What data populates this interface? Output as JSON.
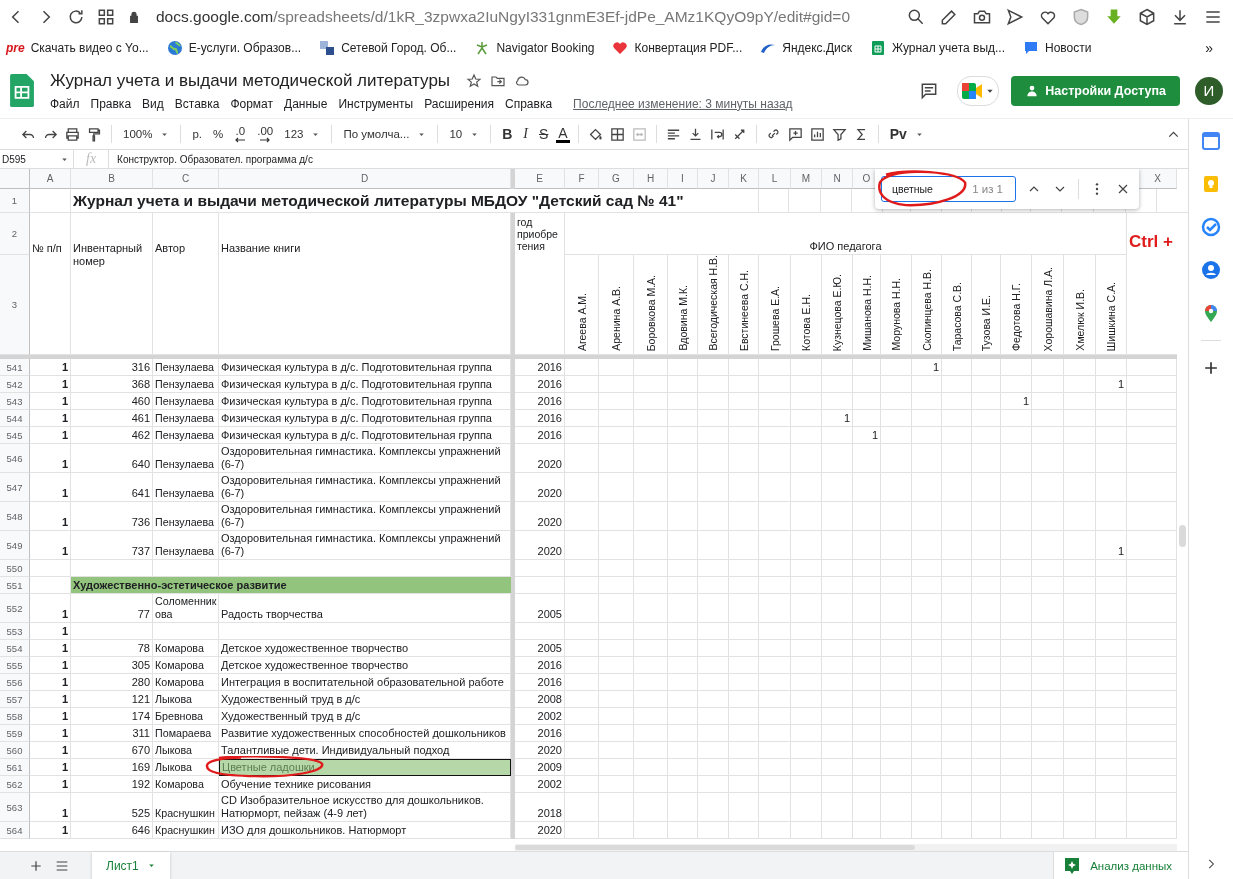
{
  "browser": {
    "url_host": "docs.google.com",
    "url_path": "/spreadsheets/d/1kR_3zpwxa2IuNgyI331gnmE3Ef-jdPe_AMz1KQyO9pY/edit#gid=0",
    "bookmarks": [
      {
        "kind": "pre",
        "logo": "pre",
        "label": "Скачать видео с Yo..."
      },
      {
        "kind": "globe",
        "label": "Е-услуги. Образов..."
      },
      {
        "kind": "tile",
        "label": "Сетевой Город. Об..."
      },
      {
        "kind": "figure",
        "label": "Navigator Booking"
      },
      {
        "kind": "heart",
        "label": "Конвертация PDF..."
      },
      {
        "kind": "disk",
        "label": "Яндекс.Диск"
      },
      {
        "kind": "sheets",
        "label": "Журнал учета выд..."
      },
      {
        "kind": "chat",
        "label": "Новости"
      }
    ],
    "overflow": "»"
  },
  "doc": {
    "title": "Журнал учета и выдачи методической литературы",
    "menu": [
      "Файл",
      "Правка",
      "Вид",
      "Вставка",
      "Формат",
      "Данные",
      "Инструменты",
      "Расширения",
      "Справка"
    ],
    "last_edit": "Последнее изменение: 3 минуты назад",
    "share_button": "Настройки Доступа",
    "avatar": "И"
  },
  "toolbar": [
    {
      "kind": "undo"
    },
    {
      "kind": "redo"
    },
    {
      "kind": "print"
    },
    {
      "kind": "paint"
    },
    {
      "kind": "sep"
    },
    {
      "kind": "dropdown",
      "label": "100%"
    },
    {
      "kind": "sep"
    },
    {
      "kind": "text",
      "label": "р."
    },
    {
      "kind": "text",
      "label": "%"
    },
    {
      "kind": "dec_less",
      "label": ".0"
    },
    {
      "kind": "dec_more",
      "label": ".00"
    },
    {
      "kind": "dropdown",
      "label": "123"
    },
    {
      "kind": "sep"
    },
    {
      "kind": "dropdown",
      "label": "По умолча..."
    },
    {
      "kind": "sep"
    },
    {
      "kind": "dropdown",
      "label": "10"
    },
    {
      "kind": "sep"
    },
    {
      "kind": "bold",
      "label": "B"
    },
    {
      "kind": "italic",
      "label": "I"
    },
    {
      "kind": "strike",
      "label": "S"
    },
    {
      "kind": "color",
      "label": "A"
    },
    {
      "kind": "sep"
    },
    {
      "kind": "fill"
    },
    {
      "kind": "borders"
    },
    {
      "kind": "merge"
    },
    {
      "kind": "sep"
    },
    {
      "kind": "halign"
    },
    {
      "kind": "valign"
    },
    {
      "kind": "wrap"
    },
    {
      "kind": "rotate"
    },
    {
      "kind": "sep"
    },
    {
      "kind": "link"
    },
    {
      "kind": "comment"
    },
    {
      "kind": "chart"
    },
    {
      "kind": "filter"
    },
    {
      "kind": "sigma"
    },
    {
      "kind": "sep"
    },
    {
      "kind": "addon",
      "label": "Pv"
    }
  ],
  "formula": {
    "cell": "D595",
    "fx": "fx",
    "content": "Конструктор. Образовател. программа д/с"
  },
  "find": {
    "query": "цветные",
    "count": "1 из 1"
  },
  "sheet": {
    "columns": [
      "A",
      "B",
      "C",
      "D",
      "E",
      "F",
      "G",
      "H",
      "I",
      "J",
      "K",
      "L",
      "M",
      "N",
      "O"
    ],
    "last_column": "X",
    "frozen_row_numbers": [
      "1",
      "2",
      "3"
    ],
    "title": "Журнал учета и выдачи методической литературы МБДОУ \"Детский сад № 41\"",
    "headers": [
      "№ п/п",
      "Инвентарный номер",
      "Автор",
      "Название книги",
      "год приобретения"
    ],
    "teacher_group": "ФИО педагога",
    "hint": "Ctrl +",
    "teachers": [
      "Агеева А.М.",
      "Аренина А.В.",
      "Боровкова М.А.",
      "Вдовина М.К.",
      "Всегодическая Н.В.",
      "Евстинеева С.Н.",
      "Грошева Е.А.",
      "Котова Е.Н.",
      "Кузнецова Е.Ю.",
      "Мишанова Н.Н.",
      "Морунова Н.Н.",
      "Скопинцева Н.В.",
      "Тарасова С.В.",
      "Тузова И.Е.",
      "Федотова Н.Г.",
      "Хорошавина Л.А.",
      "Хмелюк И.В.",
      "Шишкина С.А."
    ],
    "rows": [
      {
        "kind": "item",
        "num": "541",
        "a": "1",
        "b": "316",
        "c": "Пензулаева",
        "d": "Физическая культура в д/с. Подготовительная группа",
        "e": "2016",
        "found": false,
        "marks": {
          "Q": "1"
        }
      },
      {
        "kind": "item",
        "num": "542",
        "a": "1",
        "b": "368",
        "c": "Пензулаева",
        "d": "Физическая культура в д/с. Подготовительная группа",
        "e": "2016",
        "found": false,
        "marks": {
          "W": "1"
        }
      },
      {
        "kind": "item",
        "num": "543",
        "a": "1",
        "b": "460",
        "c": "Пензулаева",
        "d": "Физическая культура в д/с. Подготовительная группа",
        "e": "2016",
        "found": false,
        "marks": {
          "T": "1"
        }
      },
      {
        "kind": "item",
        "num": "544",
        "a": "1",
        "b": "461",
        "c": "Пензулаева",
        "d": "Физическая культура в д/с. Подготовительная группа",
        "e": "2016",
        "found": false,
        "marks": {
          "N": "1"
        }
      },
      {
        "kind": "item",
        "num": "545",
        "a": "1",
        "b": "462",
        "c": "Пензулаева",
        "d": "Физическая культура в д/с. Подготовительная группа",
        "e": "2016",
        "found": false,
        "marks": {
          "O": "1"
        }
      },
      {
        "kind": "item",
        "num": "546",
        "a": "1",
        "b": "640",
        "c": "Пензулаева",
        "d": "Оздоровительная гимнастика. Комплексы упражнений (6-7)",
        "e": "2020",
        "found": false
      },
      {
        "kind": "item",
        "num": "547",
        "a": "1",
        "b": "641",
        "c": "Пензулаева",
        "d": "Оздоровительная гимнастика. Комплексы упражнений (6-7)",
        "e": "2020",
        "found": false
      },
      {
        "kind": "item",
        "num": "548",
        "a": "1",
        "b": "736",
        "c": "Пензулаева",
        "d": "Оздоровительная гимнастика. Комплексы упражнений (6-7)",
        "e": "2020",
        "found": false
      },
      {
        "kind": "item",
        "num": "549",
        "a": "1",
        "b": "737",
        "c": "Пензулаева",
        "d": "Оздоровительная гимнастика. Комплексы упражнений (6-7)",
        "e": "2020",
        "found": false,
        "marks": {
          "W": "1"
        }
      },
      {
        "kind": "blank",
        "num": "550"
      },
      {
        "kind": "section",
        "num": "551",
        "label": "Художественно-эстетическое развитие"
      },
      {
        "kind": "item",
        "num": "552",
        "a": "1",
        "b": "77",
        "c": "Соломенникова",
        "d": "Радость творчества",
        "e": "2005",
        "found": false
      },
      {
        "kind": "item",
        "num": "553",
        "a": "1",
        "found": false
      },
      {
        "kind": "item",
        "num": "554",
        "a": "1",
        "b": "78",
        "c": "Комарова",
        "d": "Детское художественное творчество",
        "e": "2005",
        "found": false
      },
      {
        "kind": "item",
        "num": "555",
        "a": "1",
        "b": "305",
        "c": "Комарова",
        "d": "Детское художественное творчество",
        "e": "2016",
        "found": false
      },
      {
        "kind": "item",
        "num": "556",
        "a": "1",
        "b": "280",
        "c": "Комарова",
        "d": "Интеграция в воспитательной образовательной работе",
        "e": "2016",
        "found": false
      },
      {
        "kind": "item",
        "num": "557",
        "a": "1",
        "b": "121",
        "c": "Лыкова",
        "d": "Художественный труд в д/с",
        "e": "2008",
        "found": false
      },
      {
        "kind": "item",
        "num": "558",
        "a": "1",
        "b": "174",
        "c": "Бревнова",
        "d": "Художественный труд в д/с",
        "e": "2002",
        "found": false
      },
      {
        "kind": "item",
        "num": "559",
        "a": "1",
        "b": "311",
        "c": "Помараева",
        "d": "Развитие художественных способностей дошкольников",
        "e": "2016",
        "found": false
      },
      {
        "kind": "item",
        "num": "560",
        "a": "1",
        "b": "670",
        "c": "Лыкова",
        "d": "Талантливые дети. Индивидуальный подход",
        "e": "2020",
        "found": false
      },
      {
        "kind": "item",
        "num": "561",
        "a": "1",
        "b": "169",
        "c": "Лыкова",
        "d": "Цветные ладошки",
        "e": "2009",
        "found": true
      },
      {
        "kind": "item",
        "num": "562",
        "a": "1",
        "b": "192",
        "c": "Комарова",
        "d": "Обучение технике рисования",
        "e": "2002",
        "found": false
      },
      {
        "kind": "item",
        "num": "563",
        "a": "1",
        "b": "525",
        "c": "Краснушкин",
        "d": "CD Изобразительное искусство для дошкольников. Натюрморт, пейзаж (4-9 лет)",
        "e": "2018",
        "found": false
      },
      {
        "kind": "item",
        "num": "564",
        "a": "1",
        "b": "646",
        "c": "Краснушкин",
        "d": "ИЗО для дошкольников. Натюрморт",
        "e": "2020",
        "found": false
      }
    ]
  },
  "bottom": {
    "tabs": [
      {
        "label": "Лист1",
        "selected": true
      }
    ],
    "explore": "Анализ данных"
  }
}
